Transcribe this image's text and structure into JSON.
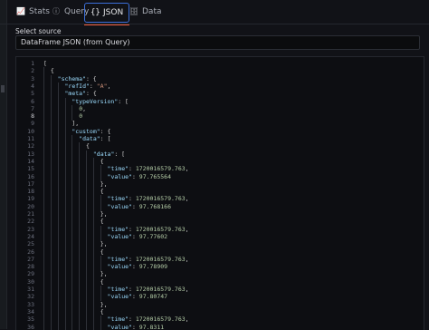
{
  "tabs": [
    {
      "label": "Stats",
      "icon": "chart-line-icon",
      "active": false
    },
    {
      "label": "Query",
      "icon": "info-circle-icon",
      "active": false
    },
    {
      "label": "JSON",
      "icon": "braces-icon",
      "active": true
    },
    {
      "label": "Data",
      "icon": "database-icon",
      "active": false
    }
  ],
  "source": {
    "label": "Select source",
    "selected": "DataFrame JSON (from Query)"
  },
  "editor": {
    "current_line": 8,
    "lines": [
      {
        "n": "1",
        "indent": 0,
        "text": "["
      },
      {
        "n": "2",
        "indent": 1,
        "text": "{"
      },
      {
        "n": "3",
        "indent": 2,
        "text": "\"schema\": {"
      },
      {
        "n": "4",
        "indent": 3,
        "text": "\"refId\": \"A\","
      },
      {
        "n": "5",
        "indent": 3,
        "text": "\"meta\": {"
      },
      {
        "n": "6",
        "indent": 4,
        "text": "\"typeVersion\": ["
      },
      {
        "n": "7",
        "indent": 5,
        "text": "0,"
      },
      {
        "n": "8",
        "indent": 5,
        "text": "0"
      },
      {
        "n": "9",
        "indent": 4,
        "text": "],"
      },
      {
        "n": "10",
        "indent": 4,
        "text": "\"custom\": {"
      },
      {
        "n": "11",
        "indent": 5,
        "text": "\"data\": ["
      },
      {
        "n": "12",
        "indent": 6,
        "text": "{"
      },
      {
        "n": "13",
        "indent": 7,
        "text": "\"data\": ["
      },
      {
        "n": "14",
        "indent": 8,
        "text": "{"
      },
      {
        "n": "15",
        "indent": 9,
        "text": "\"time\": 1720016579.763,"
      },
      {
        "n": "16",
        "indent": 9,
        "text": "\"value\": 97.765564"
      },
      {
        "n": "17",
        "indent": 8,
        "text": "},"
      },
      {
        "n": "18",
        "indent": 8,
        "text": "{"
      },
      {
        "n": "19",
        "indent": 9,
        "text": "\"time\": 1720016579.763,"
      },
      {
        "n": "20",
        "indent": 9,
        "text": "\"value\": 97.768166"
      },
      {
        "n": "21",
        "indent": 8,
        "text": "},"
      },
      {
        "n": "22",
        "indent": 8,
        "text": "{"
      },
      {
        "n": "23",
        "indent": 9,
        "text": "\"time\": 1720016579.763,"
      },
      {
        "n": "24",
        "indent": 9,
        "text": "\"value\": 97.77602"
      },
      {
        "n": "25",
        "indent": 8,
        "text": "},"
      },
      {
        "n": "26",
        "indent": 8,
        "text": "{"
      },
      {
        "n": "27",
        "indent": 9,
        "text": "\"time\": 1720016579.763,"
      },
      {
        "n": "28",
        "indent": 9,
        "text": "\"value\": 97.78909"
      },
      {
        "n": "29",
        "indent": 8,
        "text": "},"
      },
      {
        "n": "30",
        "indent": 8,
        "text": "{"
      },
      {
        "n": "31",
        "indent": 9,
        "text": "\"time\": 1720016579.763,"
      },
      {
        "n": "32",
        "indent": 9,
        "text": "\"value\": 97.80747"
      },
      {
        "n": "33",
        "indent": 8,
        "text": "},"
      },
      {
        "n": "34",
        "indent": 8,
        "text": "{"
      },
      {
        "n": "35",
        "indent": 9,
        "text": "\"time\": 1720016579.763,"
      },
      {
        "n": "36",
        "indent": 9,
        "text": "\"value\": 97.8311"
      }
    ]
  },
  "colors": {
    "accent": "#3c6fd9",
    "active_underline": "#f55f3e",
    "string": "#ce9178",
    "key": "#9cdcfe",
    "number": "#b5cea8"
  }
}
